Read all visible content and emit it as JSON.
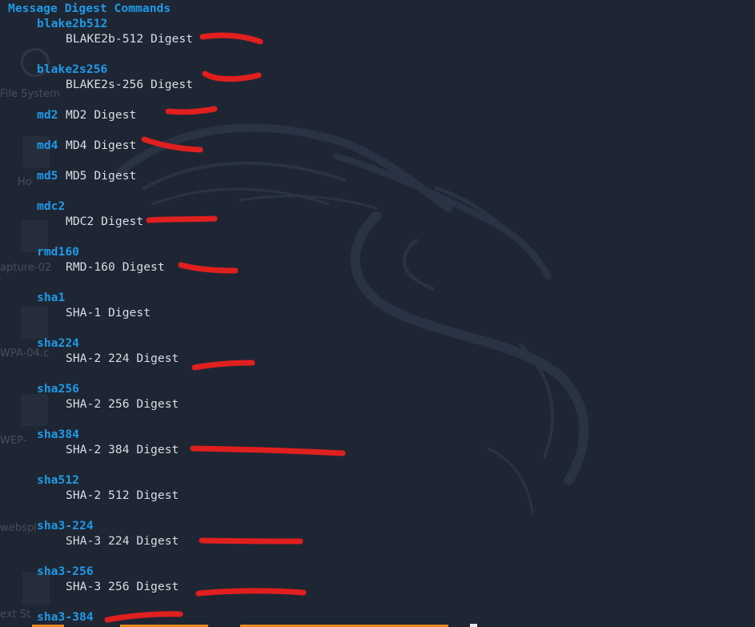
{
  "terminal": {
    "heading": "Message Digest Commands",
    "entries": [
      {
        "cmd": "blake2b512",
        "desc": "BLAKE2b-512 Digest"
      },
      {
        "cmd": "blake2s256",
        "desc": "BLAKE2s-256 Digest"
      },
      {
        "cmd": "md2",
        "desc": "MD2 Digest"
      },
      {
        "cmd": "md4",
        "desc": "MD4 Digest"
      },
      {
        "cmd": "md5",
        "desc": "MD5 Digest"
      },
      {
        "cmd": "mdc2",
        "desc": "MDC2 Digest"
      },
      {
        "cmd": "rmd160",
        "desc": "RMD-160 Digest"
      },
      {
        "cmd": "sha1",
        "desc": "SHA-1 Digest"
      },
      {
        "cmd": "sha224",
        "desc": "SHA-2 224 Digest"
      },
      {
        "cmd": "sha256",
        "desc": "SHA-2 256 Digest"
      },
      {
        "cmd": "sha384",
        "desc": "SHA-2 384 Digest"
      },
      {
        "cmd": "sha512",
        "desc": "SHA-2 512 Digest"
      },
      {
        "cmd": "sha3-224",
        "desc": "SHA-3 224 Digest"
      },
      {
        "cmd": "sha3-256",
        "desc": "SHA-3 256 Digest"
      },
      {
        "cmd": "sha3-384",
        "desc": ""
      }
    ]
  },
  "desktop": {
    "icons": [
      {
        "name": "search-icon",
        "label": "File System"
      },
      {
        "name": "home-folder-icon",
        "label": "Ho"
      },
      {
        "name": "capture-file-icon",
        "label": "apture-02"
      },
      {
        "name": "wpa-file-icon",
        "label": "WPA-04.c"
      },
      {
        "name": "wep-file-icon",
        "label": "WEP-"
      },
      {
        "name": "webspl-file-icon",
        "label": "webspl"
      },
      {
        "name": "text-file-icon",
        "label": "ext St"
      }
    ]
  },
  "colors": {
    "background": "#1f2633",
    "command": "#1e9ae8",
    "description": "#d8dde6",
    "redaction": "#e01f1f"
  }
}
